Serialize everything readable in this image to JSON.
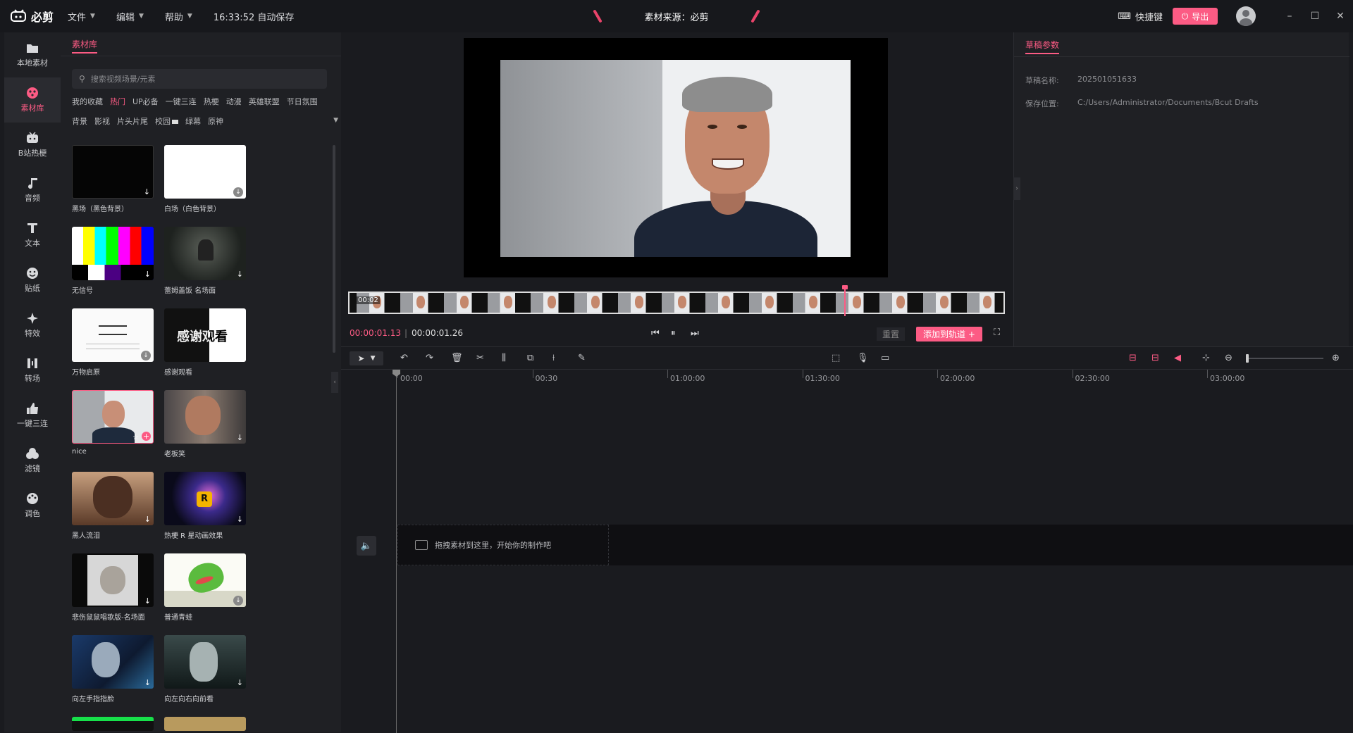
{
  "app": {
    "name": "必剪"
  },
  "menu": [
    {
      "label": "文件"
    },
    {
      "label": "编辑"
    },
    {
      "label": "帮助"
    }
  ],
  "autosave": "16:33:52 自动保存",
  "source": "素材来源：必剪",
  "topright": {
    "shortcut": "快捷键",
    "export": "导出"
  },
  "nav": [
    {
      "label": "本地素材",
      "icon": "folder-icon"
    },
    {
      "label": "素材库",
      "icon": "library-icon"
    },
    {
      "label": "B站热梗",
      "icon": "bilibili-icon"
    },
    {
      "label": "音频",
      "icon": "music-icon"
    },
    {
      "label": "文本",
      "icon": "text-icon"
    },
    {
      "label": "贴纸",
      "icon": "sticker-icon"
    },
    {
      "label": "特效",
      "icon": "effects-icon"
    },
    {
      "label": "转场",
      "icon": "transition-icon"
    },
    {
      "label": "一键三连",
      "icon": "thumbsup-icon"
    },
    {
      "label": "滤镜",
      "icon": "filter-icon"
    },
    {
      "label": "调色",
      "icon": "palette-icon"
    }
  ],
  "library": {
    "title": "素材库",
    "search_placeholder": "搜索视频场景/元素",
    "categories": [
      "我的收藏",
      "热门",
      "UP必备",
      "一键三连",
      "热梗",
      "动漫",
      "英雄联盟",
      "节日氛围",
      "背景",
      "影视",
      "片头片尾",
      "校园",
      "绿幕",
      "原神"
    ],
    "cards": [
      {
        "label": "黑场（黑色背景）"
      },
      {
        "label": "白场（白色背景）"
      },
      {
        "label": "无信号"
      },
      {
        "label": "蕾姆盖饭 名场面"
      },
      {
        "label": "万物启原"
      },
      {
        "label": "感谢观看",
        "overlay": "感谢观看"
      },
      {
        "label": "nice"
      },
      {
        "label": "老板笑"
      },
      {
        "label": "黑人流泪"
      },
      {
        "label": "热梗 R 星动画效果"
      },
      {
        "label": "悲伤鼠鼠唱歌版-名场面"
      },
      {
        "label": "普通青蛙"
      },
      {
        "label": "向左手指指脸"
      },
      {
        "label": "向左向右向前看"
      }
    ]
  },
  "player": {
    "strip_tc": "00:02",
    "current": "00:00:01.13",
    "sep": "|",
    "total": "00:00:01.26",
    "reset": "重置",
    "add_track": "添加到轨道 +"
  },
  "props": {
    "tab": "草稿参数",
    "name_label": "草稿名称:",
    "name_value": "202501051633",
    "path_label": "保存位置:",
    "path_value": "C:/Users/Administrator/Documents/Bcut Drafts"
  },
  "timeline": {
    "ticks": [
      "00:00",
      "00:30",
      "01:00:00",
      "01:30:00",
      "02:00:00",
      "02:30:00",
      "03:00:00"
    ],
    "drop_hint": "拖拽素材到这里，开始你的制作吧"
  },
  "colors": {
    "accent": "#fc5b84",
    "bg": "#1a1b1f",
    "panel": "#1f2024"
  }
}
